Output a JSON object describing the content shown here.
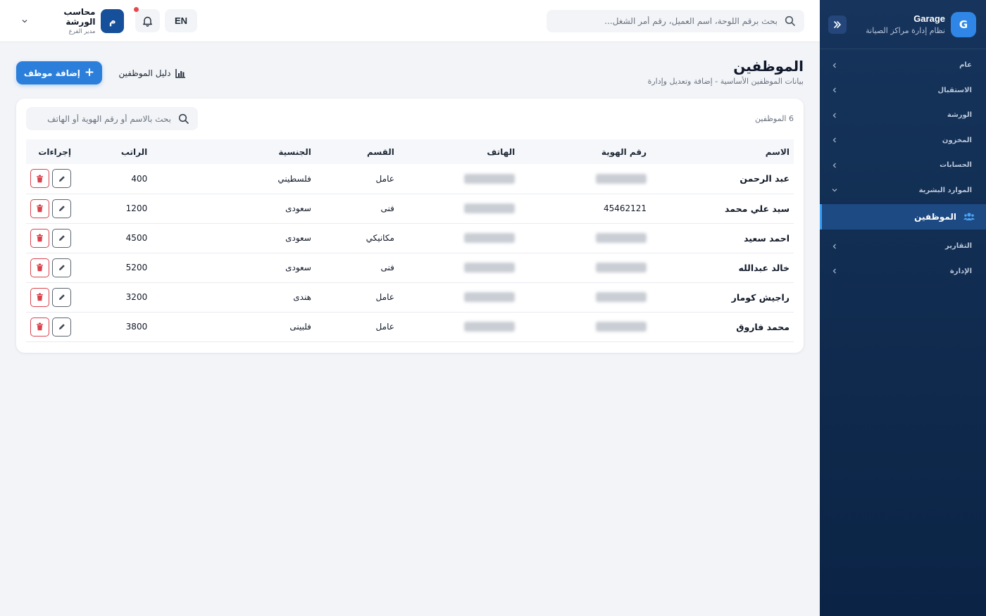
{
  "sidebar": {
    "brand_name": "Garage",
    "brand_subtitle": "نظام إدارة مراكز الصيانة",
    "brand_logo_letter": "G",
    "groups": [
      {
        "label": "عام"
      },
      {
        "label": "الاستقبال"
      },
      {
        "label": "الورشة"
      },
      {
        "label": "المخزون"
      },
      {
        "label": "الحسابات"
      },
      {
        "label": "الموارد البشرية",
        "expanded": true
      }
    ],
    "active_item": {
      "label": "الموظفين",
      "icon": "users-icon"
    },
    "groups_after": [
      {
        "label": "التقارير"
      },
      {
        "label": "الإدارة"
      }
    ]
  },
  "topbar": {
    "search_placeholder": "بحث برقم اللوحة، اسم العميل، رقم أمر الشغل...",
    "lang_label": "EN",
    "user_initial": "م",
    "user_name": "محاسب الورشة",
    "user_role": "مدير الفرع"
  },
  "page": {
    "title": "الموظفين",
    "subtitle": "بيانات الموظفين الأساسية - إضافة وتعديل وإدارة",
    "add_button": "إضافة موظف",
    "guide_button": "دليل الموظفين"
  },
  "table": {
    "count_label": "6 الموظفين",
    "search_placeholder": "بحث بالاسم أو رقم الهوية أو الهاتف",
    "columns": {
      "name": "الاسم",
      "id": "رقم الهوية",
      "phone": "الهاتف",
      "department": "القسم",
      "nationality": "الجنسية",
      "salary": "الراتب",
      "actions": "إجراءات"
    },
    "rows": [
      {
        "name": "عبد الرحمن",
        "id": "",
        "id_blurred": true,
        "department": "عامل",
        "nationality": "فلسطيني",
        "salary": "400"
      },
      {
        "name": "سيد علي محمد",
        "id": "45462121",
        "id_blurred": false,
        "department": "فنى",
        "nationality": "سعودى",
        "salary": "1200"
      },
      {
        "name": "احمد سعيد",
        "id": "",
        "id_blurred": true,
        "department": "مكانيكي",
        "nationality": "سعودى",
        "salary": "4500"
      },
      {
        "name": "خالد عبدالله",
        "id": "",
        "id_blurred": true,
        "department": "فنى",
        "nationality": "سعودى",
        "salary": "5200"
      },
      {
        "name": "راجيش كومار",
        "id": "",
        "id_blurred": true,
        "department": "عامل",
        "nationality": "هندى",
        "salary": "3200"
      },
      {
        "name": "محمد فاروق",
        "id": "",
        "id_blurred": true,
        "department": "عامل",
        "nationality": "فلبينى",
        "salary": "3800"
      }
    ]
  },
  "colors": {
    "sidebar_bg": "#16345c",
    "accent": "#2b7fdb",
    "danger": "#d9424d",
    "notification_dot": "#e5484d"
  }
}
